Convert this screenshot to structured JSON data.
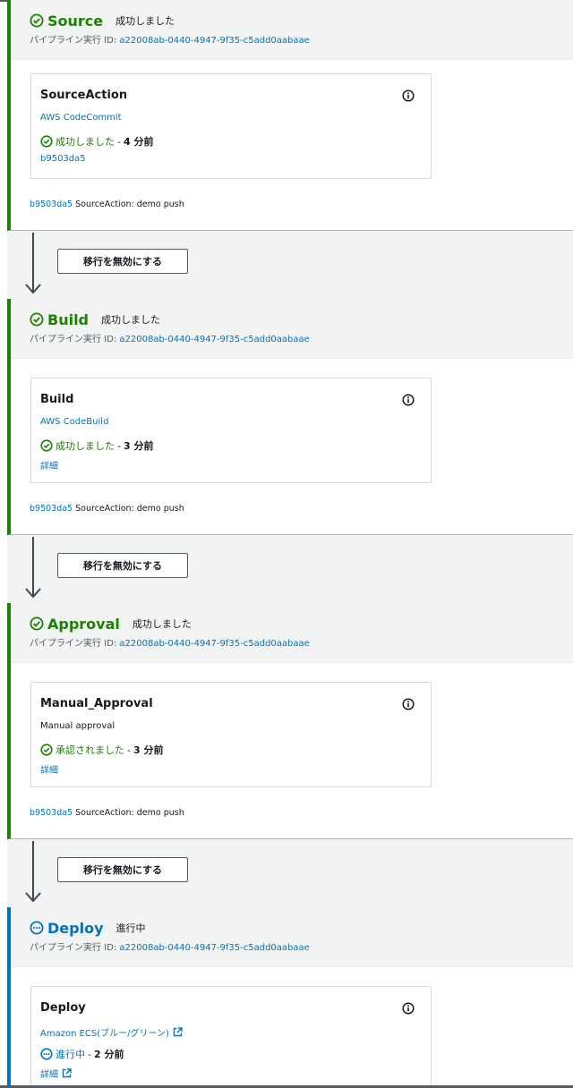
{
  "stages": [
    {
      "name": "Source",
      "status_text": "成功しました",
      "exec_label": "パイプライン実行 ID: ",
      "exec_id": "a22008ab-0440-4947-9f35-c5add0aabaae",
      "action": {
        "name": "SourceAction",
        "provider": "AWS CodeCommit",
        "status": "成功しました",
        "separator": "-",
        "time": "4 分前",
        "link": "b9503da5"
      },
      "commit_id": "b9503da5",
      "commit_message": "SourceAction: demo push"
    },
    {
      "name": "Build",
      "status_text": "成功しました",
      "exec_label": "パイプライン実行 ID: ",
      "exec_id": "a22008ab-0440-4947-9f35-c5add0aabaae",
      "action": {
        "name": "Build",
        "provider": "AWS CodeBuild",
        "status": "成功しました",
        "separator": "-",
        "time": "3 分前",
        "link": "詳細"
      },
      "commit_id": "b9503da5",
      "commit_message": "SourceAction: demo push"
    },
    {
      "name": "Approval",
      "status_text": "成功しました",
      "exec_label": "パイプライン実行 ID: ",
      "exec_id": "a22008ab-0440-4947-9f35-c5add0aabaae",
      "action": {
        "name": "Manual_Approval",
        "provider": "Manual approval",
        "status": "承認されました",
        "separator": "-",
        "time": "3 分前",
        "link": "詳細"
      },
      "commit_id": "b9503da5",
      "commit_message": "SourceAction: demo push"
    },
    {
      "name": "Deploy",
      "status_text": "進行中",
      "exec_label": "パイプライン実行 ID: ",
      "exec_id": "a22008ab-0440-4947-9f35-c5add0aabaae",
      "action": {
        "name": "Deploy",
        "provider": "Amazon ECS(ブルー/グリーン)",
        "status": "進行中",
        "separator": "-",
        "time": "2 分前",
        "link": "詳細"
      }
    }
  ],
  "transitions": [
    {
      "button_label": "移行を無効にする"
    },
    {
      "button_label": "移行を無効にする"
    },
    {
      "button_label": "移行を無効にする"
    }
  ],
  "colors": {
    "success": "#1d8102",
    "in_progress": "#0073bb",
    "link": "#0073bb"
  },
  "icons": {
    "succeeded": "check-circle-icon",
    "in_progress": "ellipsis-circle-icon",
    "info": "info-icon",
    "external": "external-link-icon",
    "arrow": "arrow-down-icon"
  }
}
